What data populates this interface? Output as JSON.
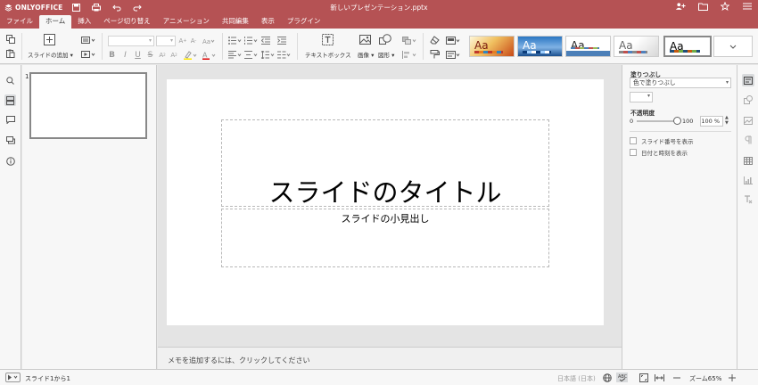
{
  "app": {
    "logo_text": "ONLYOFFICE",
    "doc_title": "新しいプレゼンテーション.pptx"
  },
  "menu": {
    "tabs": [
      {
        "label": "ファイル"
      },
      {
        "label": "ホーム"
      },
      {
        "label": "挿入"
      },
      {
        "label": "ページ切り替え"
      },
      {
        "label": "アニメーション"
      },
      {
        "label": "共同編集"
      },
      {
        "label": "表示"
      },
      {
        "label": "プラグイン"
      }
    ],
    "active_tab": "ホーム"
  },
  "toolbar": {
    "add_slide_label": "スライドの追加",
    "text_box_label": "テキストボックス",
    "image_label": "画像",
    "shape_label": "図形",
    "themes": [
      {
        "name": "theme-1",
        "sample": "Aa"
      },
      {
        "name": "theme-2",
        "sample": "Aa"
      },
      {
        "name": "theme-3",
        "sample": "Aa"
      },
      {
        "name": "theme-4",
        "sample": "Aa"
      },
      {
        "name": "theme-5",
        "sample": "Aa"
      }
    ]
  },
  "thumbnails": [
    {
      "number": "1"
    }
  ],
  "slide": {
    "title": "スライドのタイトル",
    "subtitle": "スライドの小見出し"
  },
  "notes": {
    "placeholder": "メモを追加するには、クリックしてください"
  },
  "right_panel": {
    "fill_label": "塗りつぶし",
    "fill_value": "色で塗りつぶし",
    "opacity_label": "不透明度",
    "opacity_min": "0",
    "opacity_max": "100",
    "opacity_value": "100 %",
    "opacity_level": 100,
    "show_slide_number": "スライド番号を表示",
    "show_date_time": "日付と時刻を表示"
  },
  "status": {
    "slide_counter": "スライド1から1",
    "language": "日本語 (日本)",
    "zoom": "ズーム65%"
  },
  "colors": {
    "brand": "#b55254"
  }
}
